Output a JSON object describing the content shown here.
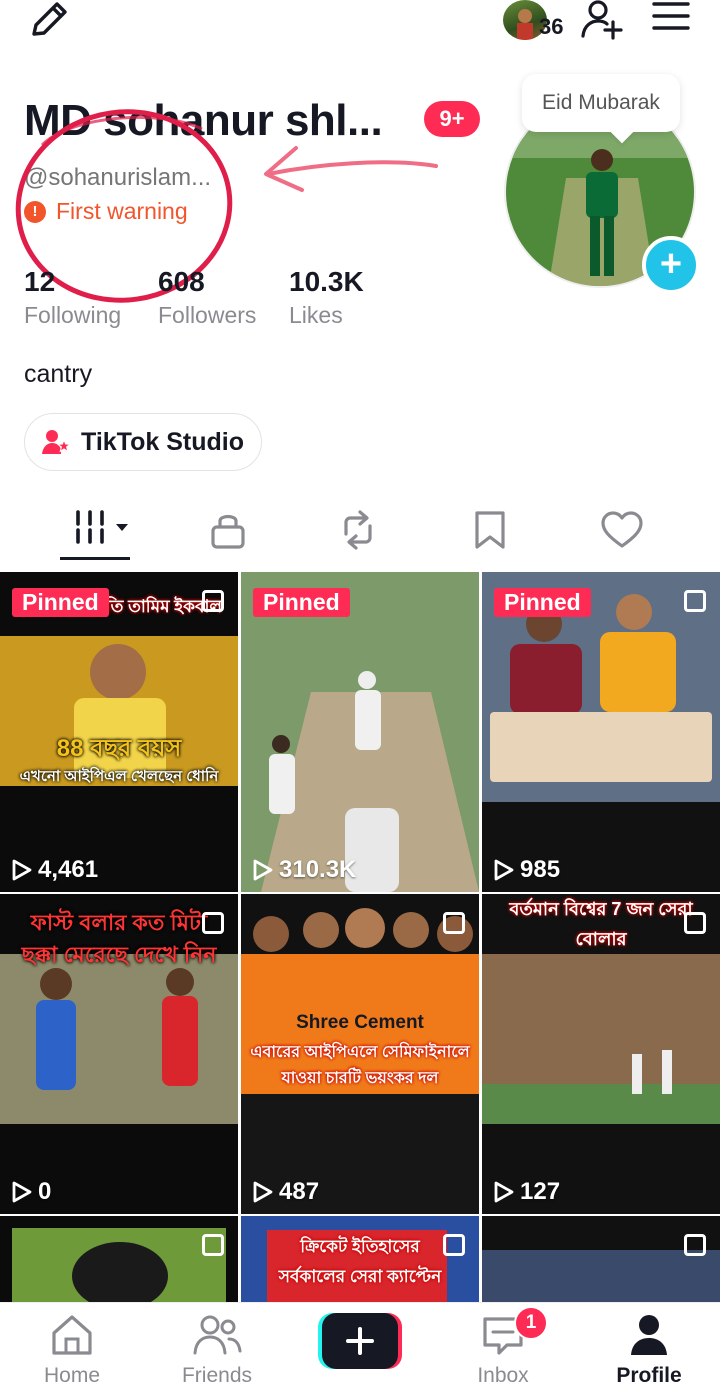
{
  "topbar": {
    "story_count": "36"
  },
  "profile": {
    "name": "MD sohanur shl...",
    "notification_badge": "9+",
    "handle": "@sohanurislam...",
    "warning": "First warning",
    "bio": "cantry",
    "studio_label": "TikTok Studio",
    "avatar_bubble": "Eid Mubarak"
  },
  "stats": [
    {
      "value": "12",
      "label": "Following"
    },
    {
      "value": "608",
      "label": "Followers"
    },
    {
      "value": "10.3K",
      "label": "Likes"
    }
  ],
  "tabs": [
    "videos-tab",
    "private-tab",
    "reposts-tab",
    "favorites-tab",
    "liked-tab"
  ],
  "videos": [
    {
      "pinned": "Pinned",
      "views": "4,461",
      "caption_top": "বিসিবি সভাপতি তামিম ইকবাল",
      "caption_main": "88 বছর বয়স",
      "caption_sub": "এখনো আইপিএল খেলছেন ধোনি"
    },
    {
      "pinned": "Pinned",
      "views": "310.3K"
    },
    {
      "pinned": "Pinned",
      "views": "985"
    },
    {
      "views": "0",
      "caption_main": "ফাস্ট বলার কত মিটা",
      "caption_sub": "ছক্কা মেরেছে দেখে নিন"
    },
    {
      "views": "487",
      "caption_main": "এবারের আইপিএলে সেমিফাইনালে",
      "caption_sub": "যাওয়া চারটি ভয়ংকর দল",
      "jersey": "Shree Cement"
    },
    {
      "views": "127",
      "caption_main": "বর্তমান বিশ্বের 7 জন সেরা",
      "caption_sub": "বোলার"
    },
    {},
    {
      "caption_main": "ক্রিকেট ইতিহাসের",
      "caption_sub": "সর্বকালের সেরা ক্যাপ্টেন"
    },
    {}
  ],
  "nav": {
    "home": "Home",
    "friends": "Friends",
    "inbox": "Inbox",
    "inbox_badge": "1",
    "profile": "Profile"
  },
  "colors": {
    "accent": "#fe2c55",
    "warning": "#f2552c",
    "cyan": "#21c4e8"
  }
}
